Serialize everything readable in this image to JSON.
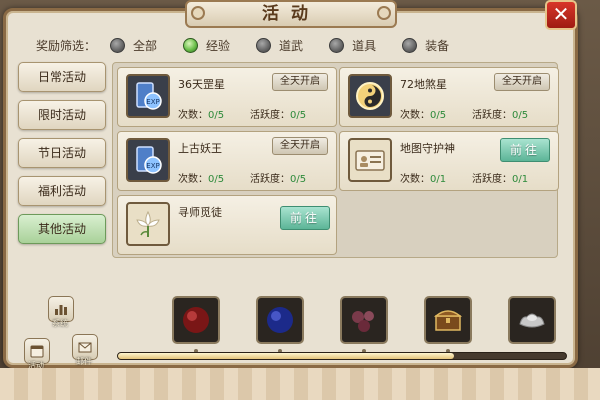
{
  "window": {
    "title": "活动",
    "close_label": "✕"
  },
  "filter": {
    "label": "奖励筛选：",
    "options": [
      {
        "label": "全部",
        "selected": false
      },
      {
        "label": "经验",
        "selected": true
      },
      {
        "label": "道武",
        "selected": false
      },
      {
        "label": "道具",
        "selected": false
      },
      {
        "label": "装备",
        "selected": false
      }
    ]
  },
  "sidebar": {
    "items": [
      {
        "label": "日常活动",
        "active": false
      },
      {
        "label": "限时活动",
        "active": false
      },
      {
        "label": "节日活动",
        "active": false
      },
      {
        "label": "福利活动",
        "active": false
      },
      {
        "label": "其他活动",
        "active": true
      }
    ]
  },
  "activities": [
    {
      "name": "36天罡星",
      "status": "全天开启",
      "count_label": "次数：",
      "count": "0/5",
      "active_label": "活跃度：",
      "active": "0/5",
      "icon": "scroll-icon"
    },
    {
      "name": "72地煞星",
      "status": "全天开启",
      "count_label": "次数：",
      "count": "0/5",
      "active_label": "活跃度：",
      "active": "0/5",
      "icon": "yin-yang-icon"
    },
    {
      "name": "上古妖王",
      "status": "全天开启",
      "count_label": "次数：",
      "count": "0/5",
      "active_label": "活跃度：",
      "active": "0/5",
      "icon": "scroll-icon"
    },
    {
      "name": "地图守护神",
      "button": "前往",
      "count_label": "次数：",
      "count": "0/1",
      "active_label": "活跃度：",
      "active": "0/1",
      "icon": "id-card-icon"
    },
    {
      "name": "寻师觅徒",
      "button": "前往",
      "icon": "lily-flower-icon"
    }
  ],
  "bottom": {
    "buttons": [
      {
        "label": "系统",
        "icon": "bar-chart-icon"
      },
      {
        "label": "活动",
        "icon": "calendar-icon"
      },
      {
        "label": "邮件",
        "icon": "mail-icon"
      }
    ],
    "rewards": [
      {
        "icon": "red-orb-icon"
      },
      {
        "icon": "blue-orb-icon"
      },
      {
        "icon": "gem-cluster-icon"
      },
      {
        "icon": "treasure-chest-icon"
      },
      {
        "icon": "silver-ingot-icon"
      }
    ],
    "progress": 0.75
  },
  "colors": {
    "accent_green": "#6bbf4a",
    "goto_button": "#5cb597",
    "close_red": "#c42a1f",
    "value_green": "#2d8a3a"
  }
}
